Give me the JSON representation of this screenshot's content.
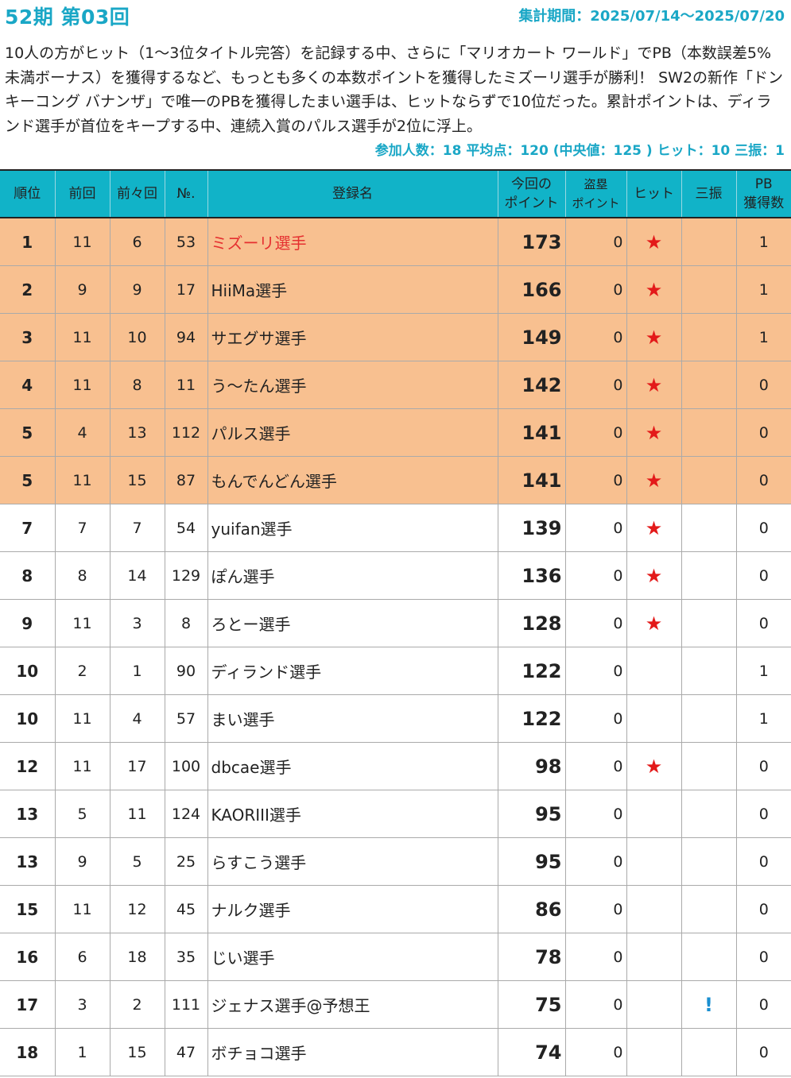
{
  "header": {
    "title": "52期 第03回",
    "period": "集計期間：2025/07/14～2025/07/20"
  },
  "summary": "10人の方がヒット（1～3位タイトル完答）を記録する中、さらに「マリオカート ワールド」でPB（本数誤差5%未満ボーナス）を獲得するなど、もっとも多くの本数ポイントを獲得したミズーリ選手が勝利！ SW2の新作「ドンキーコング バナンザ」で唯一のPBを獲得したまい選手は、ヒットならずで10位だった。累計ポイントは、ディランド選手が首位をキープする中、連続入賞のパルス選手が2位に浮上。",
  "stats": "参加人数：18 平均点：120 (中央値：125 ) ヒット：10 三振：1",
  "table": {
    "headers": {
      "rank": "順位",
      "prev": "前回",
      "prev2": "前々回",
      "no": "№.",
      "name": "登録名",
      "points_line1": "今回の",
      "points_line2": "ポイント",
      "steal_line1": "盗塁",
      "steal_line2": "ポイント",
      "hit": "ヒット",
      "strikeout": "三振",
      "pb_line1": "PB",
      "pb_line2": "獲得数"
    },
    "rows": [
      {
        "rank": "1",
        "prev": "11",
        "prev2": "6",
        "no": "53",
        "name": "ミズーリ選手",
        "points": "173",
        "steal": "0",
        "hit": "★",
        "strikeout": "",
        "pb": "1",
        "highlight": true,
        "name_red": true
      },
      {
        "rank": "2",
        "prev": "9",
        "prev2": "9",
        "no": "17",
        "name": "HiiMa選手",
        "points": "166",
        "steal": "0",
        "hit": "★",
        "strikeout": "",
        "pb": "1",
        "highlight": true
      },
      {
        "rank": "3",
        "prev": "11",
        "prev2": "10",
        "no": "94",
        "name": "サエグサ選手",
        "points": "149",
        "steal": "0",
        "hit": "★",
        "strikeout": "",
        "pb": "1",
        "highlight": true
      },
      {
        "rank": "4",
        "prev": "11",
        "prev2": "8",
        "no": "11",
        "name": "う～たん選手",
        "points": "142",
        "steal": "0",
        "hit": "★",
        "strikeout": "",
        "pb": "0",
        "highlight": true
      },
      {
        "rank": "5",
        "prev": "4",
        "prev2": "13",
        "no": "112",
        "name": "パルス選手",
        "points": "141",
        "steal": "0",
        "hit": "★",
        "strikeout": "",
        "pb": "0",
        "highlight": true
      },
      {
        "rank": "5",
        "prev": "11",
        "prev2": "15",
        "no": "87",
        "name": "もんでんどん選手",
        "points": "141",
        "steal": "0",
        "hit": "★",
        "strikeout": "",
        "pb": "0",
        "highlight": true
      },
      {
        "rank": "7",
        "prev": "7",
        "prev2": "7",
        "no": "54",
        "name": "yuifan選手",
        "points": "139",
        "steal": "0",
        "hit": "★",
        "strikeout": "",
        "pb": "0"
      },
      {
        "rank": "8",
        "prev": "8",
        "prev2": "14",
        "no": "129",
        "name": "ぽん選手",
        "points": "136",
        "steal": "0",
        "hit": "★",
        "strikeout": "",
        "pb": "0"
      },
      {
        "rank": "9",
        "prev": "11",
        "prev2": "3",
        "no": "8",
        "name": "ろとー選手",
        "points": "128",
        "steal": "0",
        "hit": "★",
        "strikeout": "",
        "pb": "0"
      },
      {
        "rank": "10",
        "prev": "2",
        "prev2": "1",
        "no": "90",
        "name": "ディランド選手",
        "points": "122",
        "steal": "0",
        "hit": "",
        "strikeout": "",
        "pb": "1"
      },
      {
        "rank": "10",
        "prev": "11",
        "prev2": "4",
        "no": "57",
        "name": "まい選手",
        "points": "122",
        "steal": "0",
        "hit": "",
        "strikeout": "",
        "pb": "1"
      },
      {
        "rank": "12",
        "prev": "11",
        "prev2": "17",
        "no": "100",
        "name": "dbcae選手",
        "points": "98",
        "steal": "0",
        "hit": "★",
        "strikeout": "",
        "pb": "0"
      },
      {
        "rank": "13",
        "prev": "5",
        "prev2": "11",
        "no": "124",
        "name": "KAORIII選手",
        "points": "95",
        "steal": "0",
        "hit": "",
        "strikeout": "",
        "pb": "0"
      },
      {
        "rank": "13",
        "prev": "9",
        "prev2": "5",
        "no": "25",
        "name": "らすこう選手",
        "points": "95",
        "steal": "0",
        "hit": "",
        "strikeout": "",
        "pb": "0"
      },
      {
        "rank": "15",
        "prev": "11",
        "prev2": "12",
        "no": "45",
        "name": "ナルク選手",
        "points": "86",
        "steal": "0",
        "hit": "",
        "strikeout": "",
        "pb": "0"
      },
      {
        "rank": "16",
        "prev": "6",
        "prev2": "18",
        "no": "35",
        "name": "じい選手",
        "points": "78",
        "steal": "0",
        "hit": "",
        "strikeout": "",
        "pb": "0"
      },
      {
        "rank": "17",
        "prev": "3",
        "prev2": "2",
        "no": "111",
        "name": "ジェナス選手@予想王",
        "points": "75",
        "steal": "0",
        "hit": "",
        "strikeout": "!",
        "pb": "0"
      },
      {
        "rank": "18",
        "prev": "1",
        "prev2": "15",
        "no": "47",
        "name": "ボチョコ選手",
        "points": "74",
        "steal": "0",
        "hit": "",
        "strikeout": "",
        "pb": "0"
      }
    ]
  },
  "colors": {
    "accent": "#1aa7c6",
    "header_bg": "#11b3c8",
    "highlight_row": "#f8c090",
    "hit_star": "#e31a1a",
    "strikeout_mark": "#1a8fd0",
    "winner_name": "#e53030"
  }
}
